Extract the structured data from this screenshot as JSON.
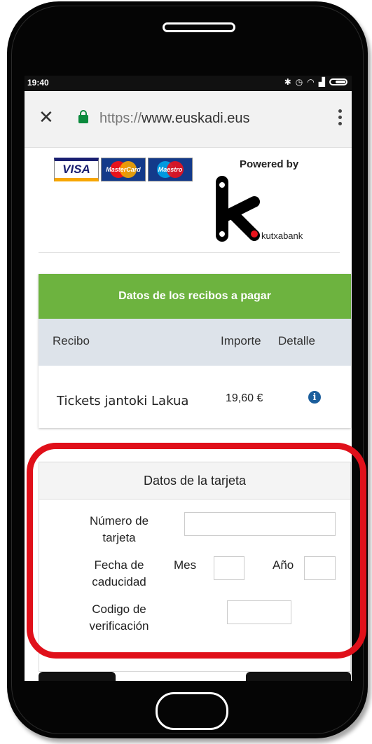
{
  "status_bar": {
    "time": "19:40",
    "icons": [
      "bluetooth-icon",
      "alarm-icon",
      "wifi-icon",
      "signal-icon",
      "battery-icon"
    ]
  },
  "browser": {
    "url_scheme": "https://",
    "url_host": "www.euskadi.eus"
  },
  "branding": {
    "card_logos": [
      "VISA",
      "MasterCard",
      "Maestro"
    ],
    "powered_by": "Powered by",
    "bank_name": "kutxabank"
  },
  "receipts": {
    "title": "Datos de los recibos a pagar",
    "columns": [
      "Recibo",
      "Importe",
      "Detalle"
    ],
    "rows": [
      {
        "recibo": "Tickets jantoki Lakua",
        "importe": "19,60 €"
      }
    ]
  },
  "card_form": {
    "title": "Datos de la tarjeta",
    "number_label_1": "Número de",
    "number_label_2": "tarjeta",
    "expiry_label_1": "Fecha de",
    "expiry_label_2": "caducidad",
    "month_label": "Mes",
    "year_label": "Año",
    "cvv_label_1": "Codigo de",
    "cvv_label_2": "verificación"
  },
  "colors": {
    "header_green": "#6db33f",
    "highlight_red": "#e0101a",
    "lock_green": "#0b8a3d"
  }
}
